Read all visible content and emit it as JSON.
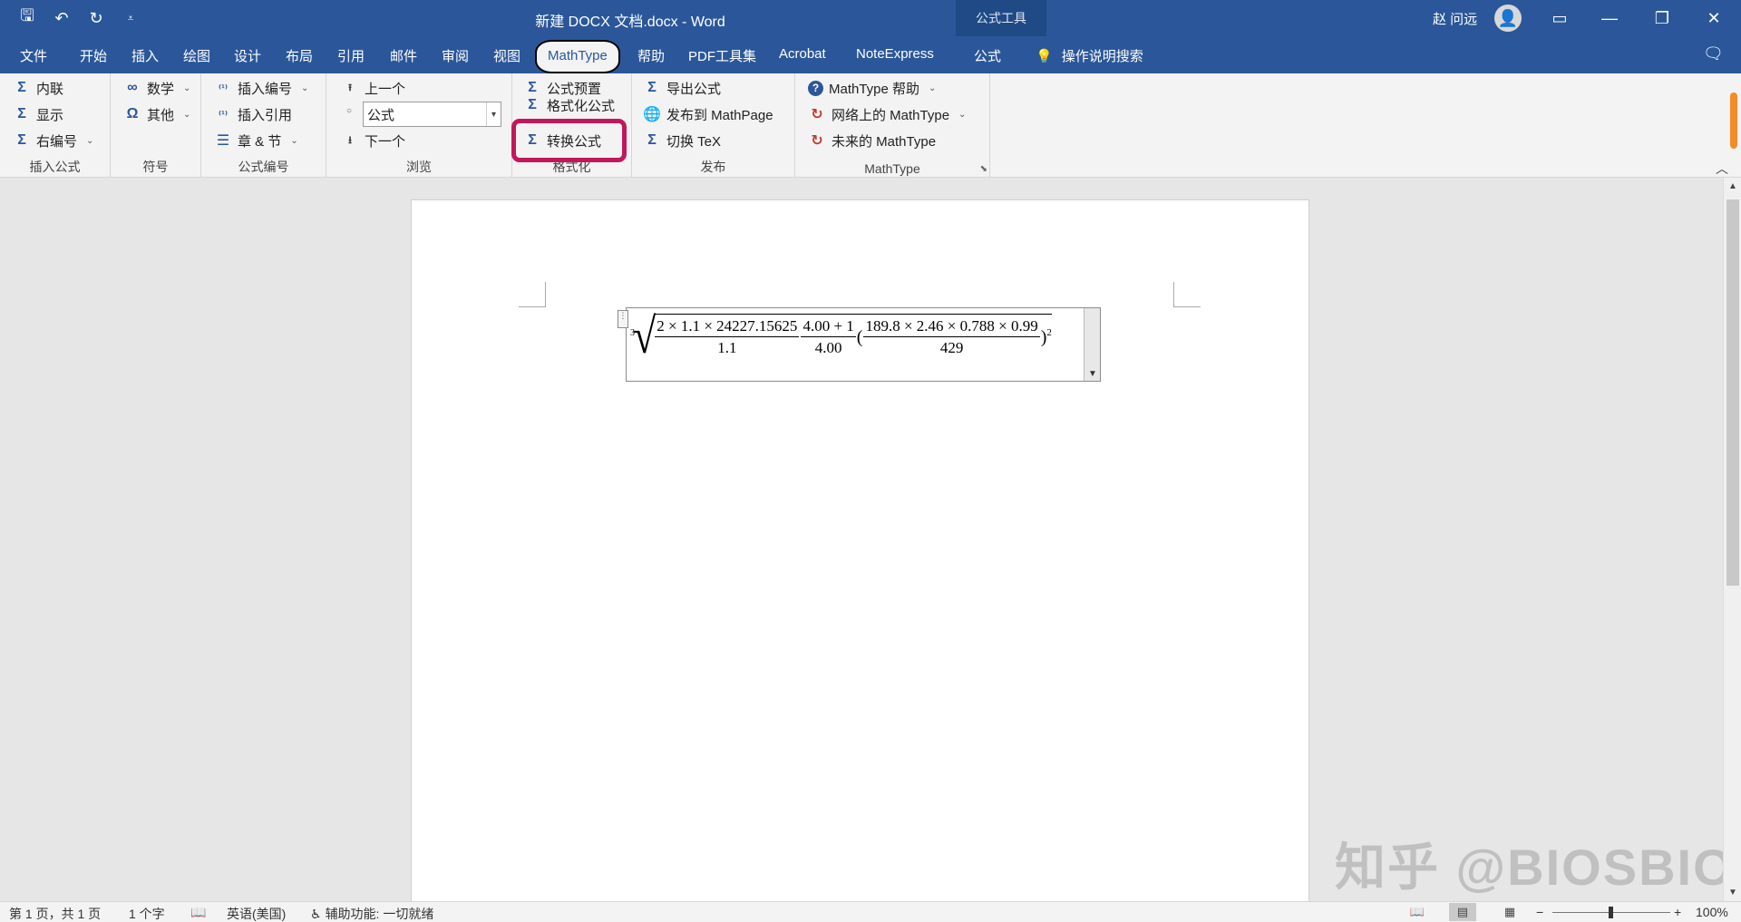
{
  "titlebar": {
    "doc_title": "新建 DOCX 文档.docx  -  Word",
    "context_tab": "公式工具",
    "user": "赵 问远"
  },
  "tabs": [
    "文件",
    "开始",
    "插入",
    "绘图",
    "设计",
    "布局",
    "引用",
    "邮件",
    "审阅",
    "视图",
    "MathType",
    "帮助",
    "PDF工具集",
    "Acrobat",
    "NoteExpress",
    "公式"
  ],
  "active_tab": "MathType",
  "search": "操作说明搜索",
  "ribbon": {
    "insert_eq": {
      "label": "插入公式",
      "inline": "内联",
      "display": "显示",
      "right_num": "右编号"
    },
    "symbols": {
      "label": "符号",
      "math": "数学",
      "other": "其他"
    },
    "eq_numbers": {
      "label": "公式编号",
      "insert_num": "插入编号",
      "insert_ref": "插入引用",
      "chapter": "章 & 节"
    },
    "browse": {
      "label": "浏览",
      "prev": "上一个",
      "value": "公式",
      "next": "下一个"
    },
    "format": {
      "label": "格式化",
      "preset": "公式预置",
      "format_eq": "格式化公式",
      "convert": "转换公式"
    },
    "publish": {
      "label": "发布",
      "export": "导出公式",
      "mathpage": "发布到 MathPage",
      "tex": "切换 TeX"
    },
    "mathtype": {
      "label": "MathType",
      "help": "MathType 帮助",
      "web": "网络上的 MathType",
      "future": "未来的 MathType"
    }
  },
  "equation": {
    "index": "3",
    "f1_num": "2 × 1.1 × 24227.15625",
    "f1_den": "1.1",
    "f2_num": "4.00 + 1",
    "f2_den": "4.00",
    "f3_num": "189.8 × 2.46 × 0.788 × 0.99",
    "f3_den": "429",
    "open_paren": "(",
    "close_paren": ")",
    "power": "2"
  },
  "watermark": "知乎 @BIOSBIO",
  "status": {
    "page": "第 1 页，共 1 页",
    "words": "1 个字",
    "language": "英语(美国)",
    "accessibility": "辅助功能: 一切就绪",
    "zoom": "100%"
  }
}
